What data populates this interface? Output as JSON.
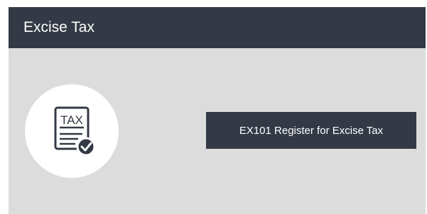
{
  "header": {
    "title": "Excise Tax"
  },
  "tax_icon": {
    "icon": "tax-document-check-icon",
    "label": "TAX"
  },
  "actions": {
    "register_label": "EX101 Register for Excise Tax"
  },
  "colors": {
    "header_bg": "#333a45",
    "body_bg": "#dcdcdc",
    "button_bg": "#333a45",
    "icon_color": "#333a45"
  }
}
